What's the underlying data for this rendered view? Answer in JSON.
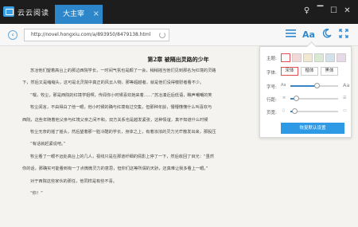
{
  "app": {
    "name": "云云阅读",
    "tab_label": "大主宰",
    "tab_close": "×"
  },
  "window_controls": [
    "♀",
    "▔",
    "☐",
    "✕"
  ],
  "address_bar": {
    "back": "‹",
    "url": "http://novel.hongxiu.com/a/893950/8479138.html"
  },
  "toolbar": {
    "icons": [
      "list-icon",
      "font-size-icon",
      "night-mode-icon",
      "fullscreen-icon"
    ],
    "font_size_label": "Aa"
  },
  "chapter": {
    "title": "第2章 被隔出灵路的少年",
    "paragraphs": [
      "苏冶他们望着高台上的那边西院学长，一时间气氛也是颇了一会，稍稍摇当他们见到那名为红境的灵路",
      "下，然后又是缩缩头，这可是北灵院中真正的风云人物，那等超越者，就是他们没得敬慰者看不少。",
      "“嘿，牧尘，那是西院的红境学姐啊，传闻你小时候喜欢她来着……”苏冶凑近后低语，瞧声嘲嘲的笑",
      "牧尘闻言，不由得白了他一眼，他小时候的确与红境有过交集，但那种年龄，懵懵懂懂什么叫喜欢与",
      "西院，这些年随着他父亲与红境父亲之间不和，双方关系也是越发紧张，这种情谊，真不知道什么时候",
      "牧尘无奈的摇了摇头，然后望着那一脸冷酷的学长，身体之上，有着浓浓的灵力光芒散发出来，那股压",
      "“有话就赶紧说吧。”",
      "牧尘看了一眼不远处高台上的几人，视线只是在那道纤细的倩影上停了一下，然后收回了目光：“虽然",
      "你的话，那确实可能看到有一丁点微微灵力的意思，但你们这等所谓的天骄，还真难让我多看上一眼。”",
      "对于西院这些家伙的那任，他同样是有些不喜。",
      "“你！”"
    ]
  },
  "settings_popup": {
    "theme_label": "主题:",
    "theme_colors": [
      "#ffffff",
      "#f3d6d6",
      "#f2e7cf",
      "#d9e9d2",
      "#d3e2ea",
      "#e8d9e9"
    ],
    "font_label": "字体:",
    "fonts": [
      "宋体",
      "楷体",
      "黑体"
    ],
    "fontsize_label": "字号:",
    "fontsize_small": "Aa",
    "fontsize_big": "Aa",
    "fontsize_value": 0.55,
    "linespacing_label": "行距:",
    "linespacing_value": 0.12,
    "width_label": "页宽:",
    "width_value": 0.08,
    "reset_label": "恢复默认设置"
  },
  "colors": {
    "accent": "#2e9ae6",
    "titlebar": "#1d1d1d",
    "paper": "#f5f3ef"
  }
}
